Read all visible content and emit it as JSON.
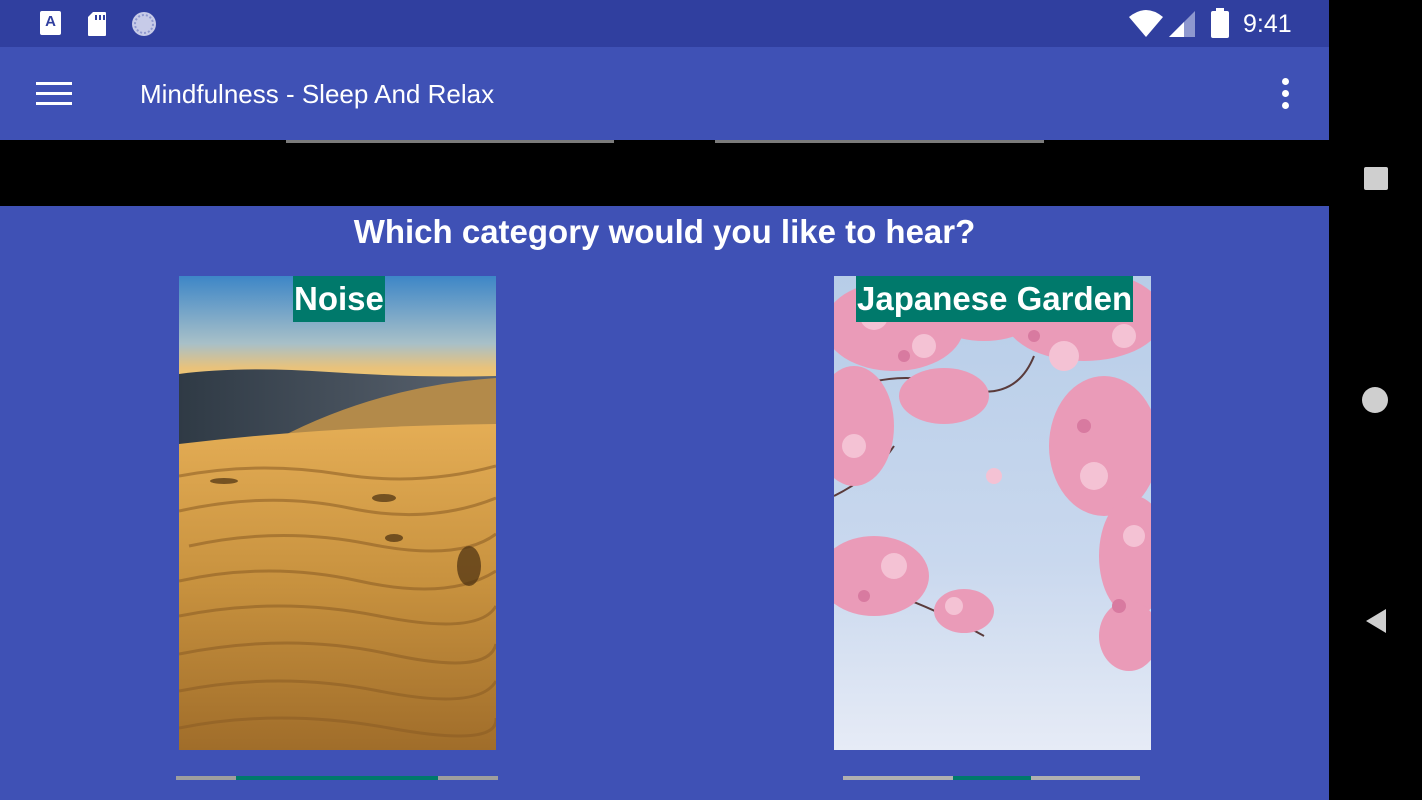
{
  "status_bar": {
    "time": "9:41",
    "icons": [
      "a-badge-icon",
      "sd-card-icon",
      "sync-spinner-icon",
      "wifi-icon",
      "cell-signal-icon",
      "battery-icon"
    ],
    "a_badge": "A"
  },
  "toolbar": {
    "title": "Mindfulness - Sleep And Relax",
    "menu_icon": "hamburger-menu-icon",
    "overflow_icon": "more-vert-icon"
  },
  "main": {
    "question": "Which category would you like to hear?",
    "categories": [
      {
        "label": "Noise",
        "image": "desert-sand-dunes-photo"
      },
      {
        "label": "Japanese Garden",
        "image": "cherry-blossom-photo"
      }
    ]
  },
  "colors": {
    "status_bar": "#303f9f",
    "primary": "#3f51b5",
    "label_bg": "#00796b",
    "indicator_active": "#00796b",
    "indicator_inactive": "#9e9e9e"
  },
  "nav_bar": {
    "icons": [
      "recents-square-icon",
      "home-circle-icon",
      "back-triangle-icon"
    ]
  }
}
